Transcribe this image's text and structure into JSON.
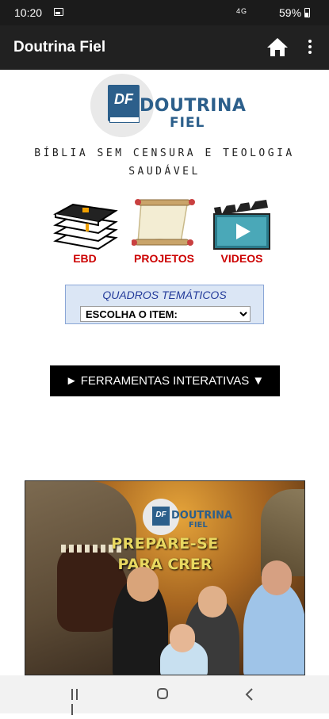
{
  "status_bar": {
    "time": "10:20",
    "signal": "4G",
    "battery": "59%"
  },
  "app_bar": {
    "title": "Doutrina Fiel"
  },
  "logo": {
    "letters": "DF",
    "line1": "DOUTRINA",
    "line2": "FIEL"
  },
  "tagline": "BÍBLIA SEM CENSURA E TEOLOGIA SAUDÁVEL",
  "icon_links": [
    {
      "label": "EBD",
      "icon": "books-icon"
    },
    {
      "label": "PROJETOS",
      "icon": "scroll-icon"
    },
    {
      "label": "VIDEOS",
      "icon": "clapperboard-icon"
    }
  ],
  "quadros": {
    "title": "QUADROS TEMÁTICOS",
    "selected": "ESCOLHA O ITEM:"
  },
  "ferramentas_button": "► FERRAMENTAS INTERATIVAS ▼",
  "banner": {
    "logo_letters": "DF",
    "logo_line1": "DOUTRINA",
    "logo_line2": "FIEL",
    "headline_1": "PREPARE-SE",
    "headline_2": "PARA CRER"
  },
  "colors": {
    "app_bar": "#212121",
    "logo_blue": "#2c5f8b",
    "link_red": "#cc0000",
    "quadros_bg": "#dbe6f5"
  }
}
